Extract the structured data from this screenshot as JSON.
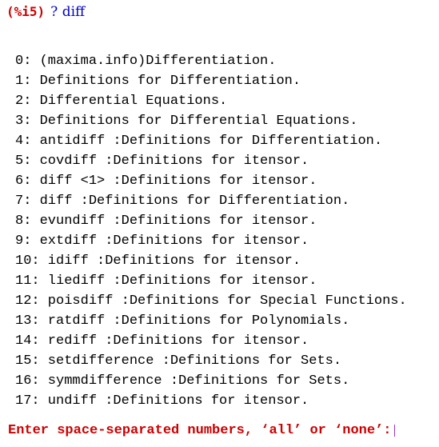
{
  "input": {
    "prompt": "(%i5)",
    "command": "? diff"
  },
  "results": [
    "0: (maxima.info)Differentiation.",
    "1: Definitions for Differentiation.",
    "2: Differential Equations.",
    "3: Definitions for Differential Equations.",
    "4: antidiff :Definitions for Differentiation.",
    "5: covdiff :Definitions for itensor.",
    "6: diff <1> :Definitions for itensor.",
    "7: diff :Definitions for Differentiation.",
    "8: evundiff :Definitions for itensor.",
    "9: extdiff :Definitions for itensor.",
    "10: idiff :Definitions for itensor.",
    "11: liediff :Definitions for itensor.",
    "12: poisdiff :Definitions for Special Functions.",
    "13: ratdiff :Definitions for Polynomials.",
    "14: rediff :Definitions for itensor.",
    "15: setdifference :Definitions for Sets.",
    "16: symmdifference :Definitions for Sets.",
    "17: undiff :Definitions for itensor."
  ],
  "selection_prompt": "Enter space-separated numbers, ‘all’ or ‘none’:",
  "colors": {
    "prompt": "#cc0000",
    "command": "#0000cc",
    "output": "#000000",
    "cursor": "#9933cc"
  }
}
